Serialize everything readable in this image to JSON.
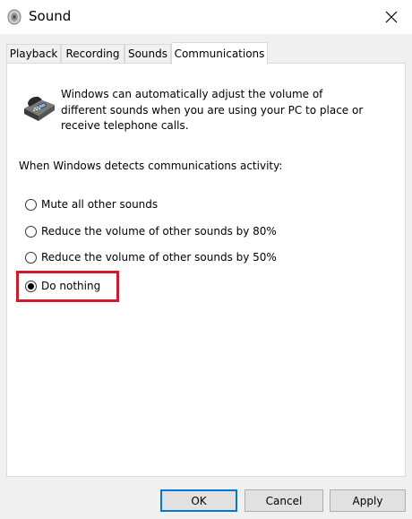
{
  "window": {
    "title": "Sound"
  },
  "tabs": [
    {
      "label": "Playback"
    },
    {
      "label": "Recording"
    },
    {
      "label": "Sounds"
    },
    {
      "label": "Communications",
      "active": true
    }
  ],
  "panel": {
    "description": "Windows can automatically adjust the volume of different sounds when you are using your PC to place or receive telephone calls.",
    "detect_label": "When Windows detects communications activity:",
    "options": [
      {
        "label": "Mute all other sounds",
        "selected": false
      },
      {
        "label": "Reduce the volume of other sounds by 80%",
        "selected": false
      },
      {
        "label": "Reduce the volume of other sounds by 50%",
        "selected": false
      },
      {
        "label": "Do nothing",
        "selected": true
      }
    ],
    "highlight_color": "#d11a2a"
  },
  "buttons": {
    "ok": "OK",
    "cancel": "Cancel",
    "apply": "Apply"
  },
  "colors": {
    "accent": "#0078d7"
  }
}
